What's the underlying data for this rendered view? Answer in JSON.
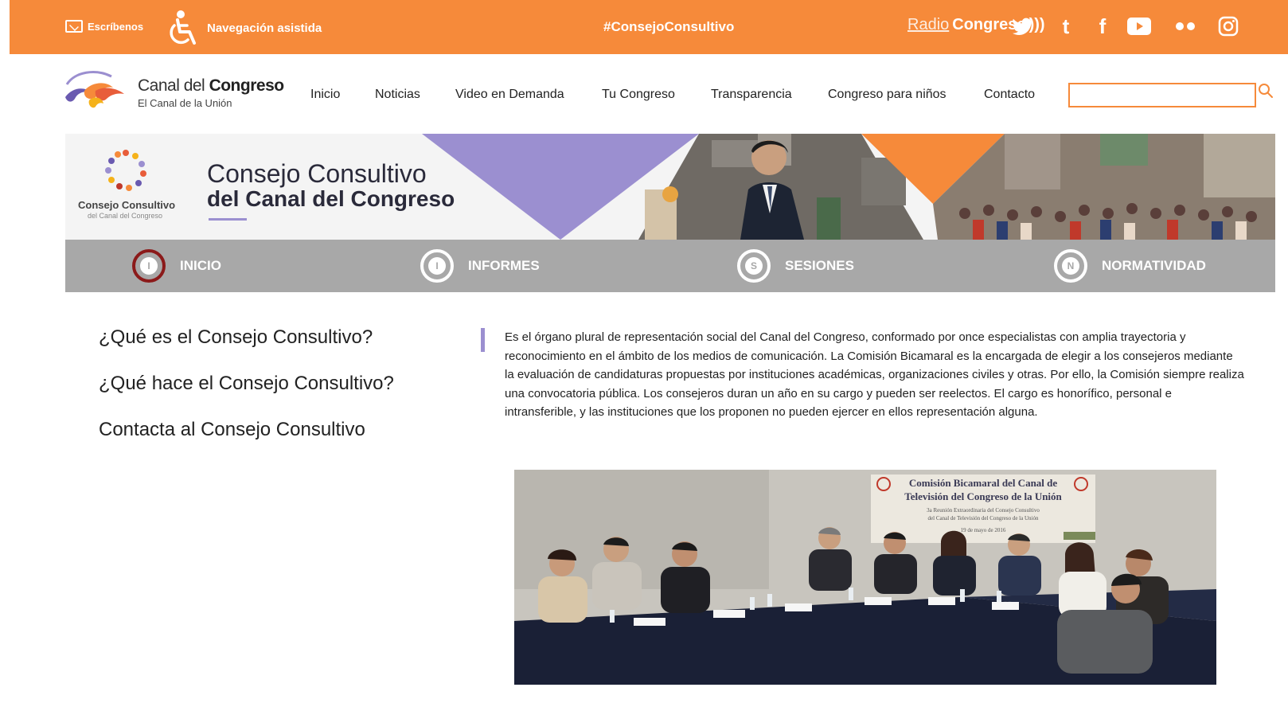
{
  "topbar": {
    "escribenos": "Escríbenos",
    "navegacion": "Navegación asistida",
    "hashtag": "#ConsejoConsultivo",
    "radio_light": "Radio",
    "radio_bold": "Congreso",
    "radio_waves": ")))",
    "accent": "#f68a3a",
    "social_icons": [
      "twitter-icon",
      "tumblr-icon",
      "facebook-icon",
      "youtube-icon",
      "flickr-icon",
      "instagram-icon"
    ]
  },
  "header": {
    "logo_light": "Canal del ",
    "logo_bold": "Congreso",
    "logo_sub": "El Canal de la Unión",
    "nav": [
      "Inicio",
      "Noticias",
      "Video en Demanda",
      "Tu Congreso",
      "Transparencia",
      "Congreso para niños",
      "Contacto"
    ],
    "search_placeholder": ""
  },
  "banner": {
    "logo_name": "Consejo Consultivo",
    "logo_sub": "del Canal del Congreso",
    "title_line1": "Consejo Consultivo",
    "title_line2": "del Canal del Congreso",
    "purple": "#9b8fd0"
  },
  "tabs": [
    {
      "letter": "I",
      "label": "INICIO",
      "active": true
    },
    {
      "letter": "I",
      "label": "INFORMES",
      "active": false
    },
    {
      "letter": "S",
      "label": "SESIONES",
      "active": false
    },
    {
      "letter": "N",
      "label": "NORMATIVIDAD",
      "active": false
    }
  ],
  "sidebar": {
    "links": [
      "¿Qué es el Consejo Consultivo?",
      "¿Qué hace el Consejo Consultivo?",
      "Contacta al Consejo Consultivo"
    ]
  },
  "main": {
    "paragraph": "Es el órgano plural de representación social del Canal del Congreso, conformado por once especialistas con amplia trayectoria y reconocimiento en el ámbito de los medios de comunicación. La Comisión Bicamaral es la encargada de elegir a los consejeros mediante la evaluación de candidaturas propuestas por instituciones académicas, organizaciones civiles y otras. Por ello, la Comisión siempre realiza una convocatoria pública. Los consejeros duran un año en su cargo y pueden ser reelectos. El cargo es honorífico, personal e intransferible, y las instituciones que los proponen no pueden ejercer en ellos representación alguna.",
    "photo_banner_line1": "Comisión Bicamaral del Canal de",
    "photo_banner_line2": "Televisión del Congreso de la Unión",
    "photo_banner_line3": "3a Reunión Extraordinaria del Consejo Consultivo",
    "photo_banner_line4": "del Canal de Televisión del Congreso de la Unión",
    "photo_banner_date": "19 de mayo de 2016"
  }
}
